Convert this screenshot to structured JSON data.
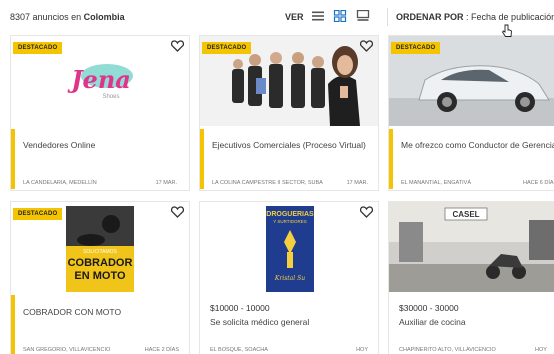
{
  "header": {
    "count_number": "8307",
    "count_text": "anuncios en",
    "count_location": "Colombia",
    "view_label": "VER",
    "sort_label": "ORDENAR POR",
    "sort_value": ": Fecha de publicación"
  },
  "icons": {
    "list_view": "list-icon",
    "grid_view": "grid-icon",
    "card_view": "card-view-icon",
    "favorite": "heart-icon"
  },
  "colors": {
    "accent": "#f5c400",
    "view_icon": "#1a73c8"
  },
  "cards": [
    {
      "badge": "DESTACADO",
      "title": "Vendedores Online",
      "location": "LA CANDELARIA, MEDELLÍN",
      "date": "17 MAR.",
      "logo_text": "Jena",
      "logo_sub": "Shoes"
    },
    {
      "badge": "DESTACADO",
      "title": "Ejecutivos Comerciales (Proceso Virtual)",
      "location": "LA COLINA CAMPESTRE II SECTOR, SUBA",
      "date": "17 MAR."
    },
    {
      "badge": "DESTACADO",
      "title": "Me ofrezco como Conductor de Gerencia...",
      "location": "EL MANANTIAL, ENGATIVÁ",
      "date": "HACE 6 DÍA"
    },
    {
      "badge": "DESTACADO",
      "title": "COBRADOR CON MOTO",
      "location": "SAN GREGORIO, VILLAVICENCIO",
      "date": "HACE 2 DÍAS",
      "poster_top": "SOLICITAMOS",
      "poster_line1": "COBRADOR",
      "poster_line2": "EN MOTO"
    },
    {
      "salary": "$10000 - 10000",
      "title": "Se solicita médico general",
      "location": "EL BOSQUE, SOACHA",
      "date": "HOY",
      "poster_line1": "DROGUERIAS",
      "poster_line2": "Y SURTIDORES",
      "poster_script": "Kristal Su"
    },
    {
      "salary": "$30000 - 30000",
      "title": "Auxiliar de cocina",
      "location": "CHAPINERITO ALTO, VILLAVICENCIO",
      "date": "HOY",
      "sign_text": "CASEL"
    }
  ]
}
